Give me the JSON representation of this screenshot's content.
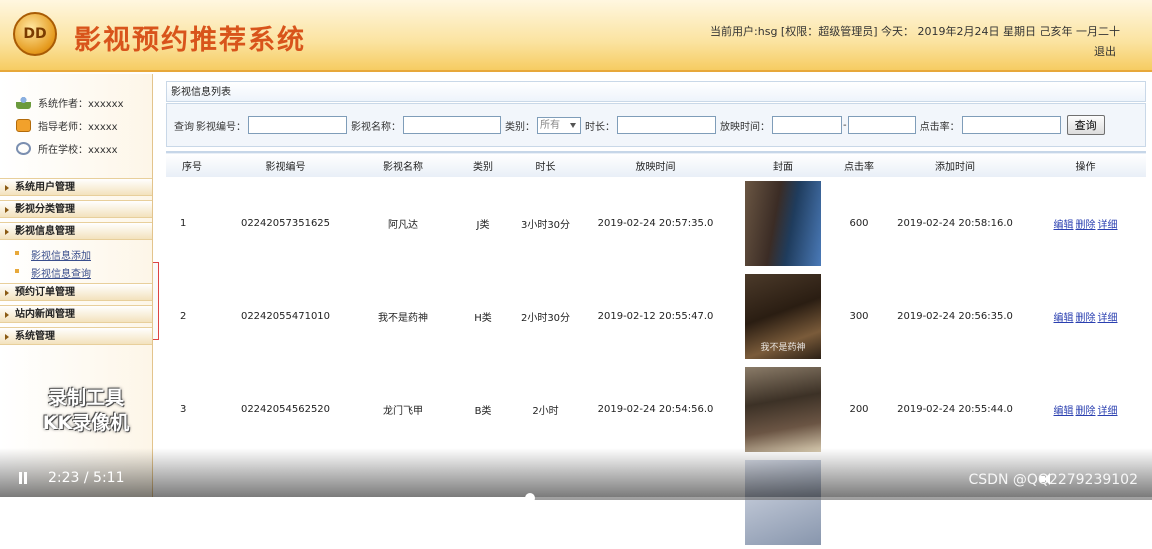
{
  "header": {
    "logo_text": "DD",
    "title": "影视预约推荐系统",
    "user_info": "当前用户:hsg [权限：超级管理员] 今天： 2019年2月24日 星期日 己亥年 一月二十",
    "logout": "退出"
  },
  "sidebar": {
    "info": [
      {
        "label": "系统作者：xxxxxx"
      },
      {
        "label": "指导老师：xxxxx"
      },
      {
        "label": "所在学校：xxxxx"
      }
    ],
    "menu": {
      "user_mgmt": "系统用户管理",
      "category_mgmt": "影视分类管理",
      "film_mgmt": "影视信息管理",
      "film_add": "影视信息添加",
      "film_query": "影视信息查询",
      "order_mgmt": "预约订单管理",
      "news_mgmt": "站内新闻管理",
      "sys_mgmt": "系统管理"
    },
    "watermark": [
      "录制工具",
      "KK录像机"
    ]
  },
  "main": {
    "panel_title": "影视信息列表",
    "search": {
      "label_query": "查询",
      "label_code": "影视编号：",
      "label_name": "影视名称：",
      "label_category": "类别：",
      "category_value": "所有",
      "label_duration": "时长：",
      "label_showtime": "放映时间：",
      "label_dash": "-",
      "label_clicks": "点击率：",
      "button": "查询"
    },
    "columns": [
      "序号",
      "影视编号",
      "影视名称",
      "类别",
      "时长",
      "放映时间",
      "封面",
      "点击率",
      "添加时间",
      "操作"
    ],
    "rows": [
      {
        "no": "1",
        "code": "02242057351625",
        "name": "阿凡达",
        "category": "J类",
        "duration": "3小时30分",
        "showtime": "2019-02-24 20:57:35.0",
        "clicks": "600",
        "added": "2019-02-24 20:58:16.0"
      },
      {
        "no": "2",
        "code": "02242055471010",
        "name": "我不是药神",
        "category": "H类",
        "duration": "2小时30分",
        "showtime": "2019-02-12 20:55:47.0",
        "cover_caption": "我不是药神",
        "clicks": "300",
        "added": "2019-02-24 20:56:35.0"
      },
      {
        "no": "3",
        "code": "02242054562520",
        "name": "龙门飞甲",
        "category": "B类",
        "duration": "2小时",
        "showtime": "2019-02-24 20:54:56.0",
        "clicks": "200",
        "added": "2019-02-24 20:55:44.0"
      }
    ],
    "ops": {
      "edit": "编辑",
      "delete": "删除",
      "detail": "详细"
    }
  },
  "video": {
    "time": "2:23 / 5:11",
    "progress": 0.46,
    "watermark": "CSDN @QQ2279239102"
  }
}
